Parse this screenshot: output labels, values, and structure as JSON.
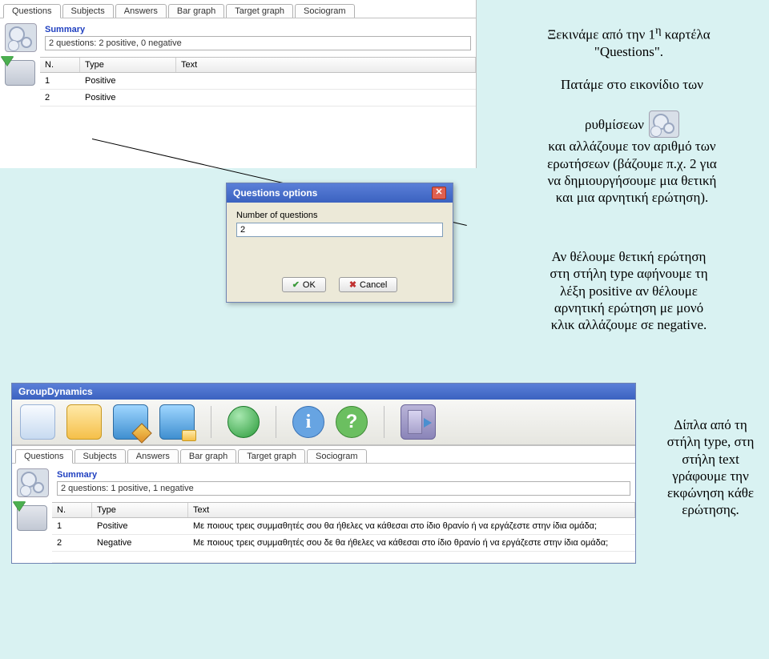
{
  "app1": {
    "tabs": [
      "Questions",
      "Subjects",
      "Answers",
      "Bar graph",
      "Target graph",
      "Sociogram"
    ],
    "active_tab": 0,
    "summary_title": "Summary",
    "summary_text": "2 questions: 2 positive, 0 negative",
    "columns": {
      "n": "N.",
      "type": "Type",
      "text": "Text"
    },
    "rows": [
      {
        "n": "1",
        "type": "Positive",
        "text": ""
      },
      {
        "n": "2",
        "type": "Positive",
        "text": ""
      }
    ]
  },
  "dialog": {
    "title": "Questions options",
    "label": "Number of questions",
    "value": "2",
    "ok": "OK",
    "cancel": "Cancel"
  },
  "app2": {
    "window_title": "GroupDynamics",
    "tabs": [
      "Questions",
      "Subjects",
      "Answers",
      "Bar graph",
      "Target graph",
      "Sociogram"
    ],
    "active_tab": 0,
    "summary_title": "Summary",
    "summary_text": "2 questions: 1 positive, 1 negative",
    "columns": {
      "n": "N.",
      "type": "Type",
      "text": "Text"
    },
    "rows": [
      {
        "n": "1",
        "type": "Positive",
        "text": "Με ποιους τρεις συμμαθητές σου θα ήθελες να κάθεσαι στο ίδιο θρανίο ή να εργάζεστε στην ίδια ομάδα;"
      },
      {
        "n": "2",
        "type": "Negative",
        "text": "Με ποιους τρεις συμμαθητές σου δε θα ήθελες να κάθεσαι στο ίδιο θρανίο ή να εργάζεστε στην ίδια ομάδα;"
      }
    ]
  },
  "annotations": {
    "a1_l1": "Ξεκινάμε από την 1",
    "a1_sup": "η",
    "a1_l1b": " καρτέλα",
    "a1_l2": "\"Questions\".",
    "a2_l1": "Πατάμε στο εικονίδιο των",
    "a2_l2a": "ρυθμίσεων",
    "a2_l3": "και αλλάζουμε τον αριθμό των",
    "a2_l4": "ερωτήσεων (βάζουμε π.χ. 2 για",
    "a2_l5": "να δημιουργήσουμε μια θετική",
    "a2_l6": "και μια αρνητική ερώτηση).",
    "a3_l1": "Αν θέλουμε θετική ερώτηση",
    "a3_l2": "στη στήλη type αφήνουμε τη",
    "a3_l3": "λέξη positive αν θέλουμε",
    "a3_l4": "αρνητική ερώτηση με μονό",
    "a3_l5": "κλικ αλλάζουμε σε negative.",
    "a4_l1": "Δίπλα από τη",
    "a4_l2": "στήλη type, στη",
    "a4_l3": "στήλη text",
    "a4_l4": "γράφουμε την",
    "a4_l5": "εκφώνηση κάθε",
    "a4_l6": "ερώτησης."
  }
}
